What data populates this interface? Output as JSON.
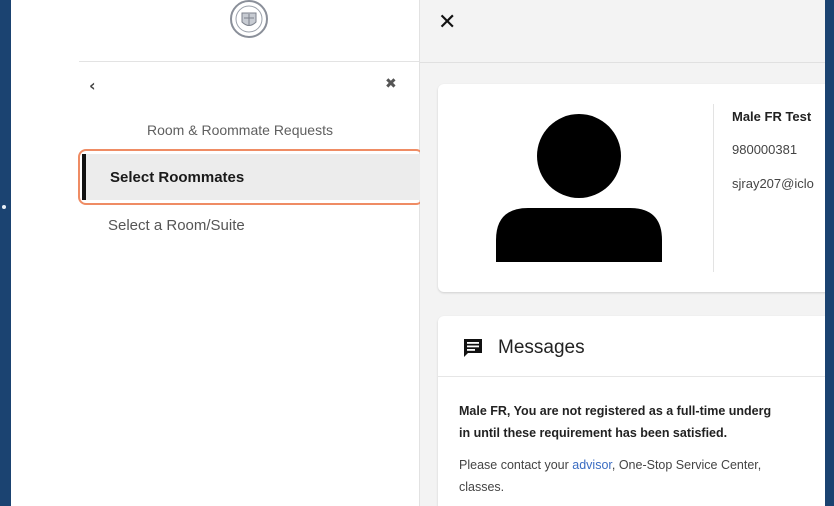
{
  "sidebar": {
    "logo_icon": "university-seal-icon",
    "back_icon": "chevron-left-icon",
    "close_icon": "close-icon",
    "heading": "Room & Roommate Requests",
    "items": [
      {
        "label": "Select Roommates",
        "active": true
      },
      {
        "label": "Select a Room/Suite",
        "active": false
      }
    ]
  },
  "main": {
    "close_icon": "close-icon",
    "profile": {
      "avatar_icon": "user-avatar-icon",
      "name": "Male FR Test",
      "id": "980000381",
      "email": "sjray207@iclo"
    },
    "messages": {
      "icon": "message-icon",
      "title": "Messages",
      "line1": "Male FR, You are not registered as a full-time underg",
      "line2": "in until these requirement has been satisfied.",
      "line3_before": "Please contact your ",
      "line3_link": "advisor",
      "line3_after": ", One-Stop Service Center,",
      "line4": "classes."
    }
  },
  "colors": {
    "background": "#1b4371",
    "highlight_border": "#ef8c64",
    "active_item_bg": "#ececec",
    "link": "#3a6cc2"
  }
}
